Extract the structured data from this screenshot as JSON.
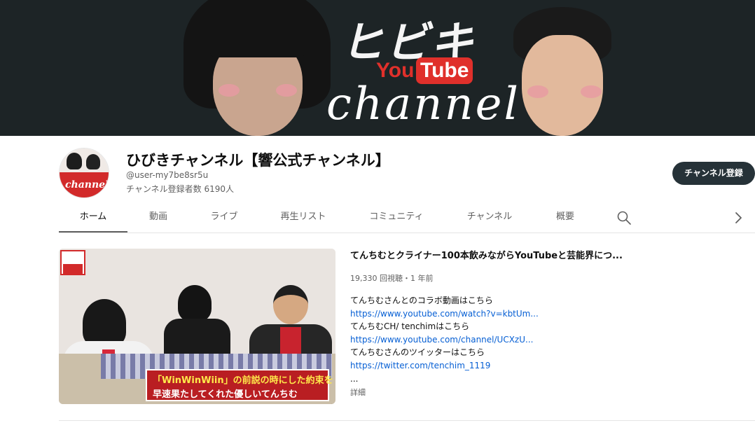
{
  "banner": {
    "title": "ヒビキ",
    "yt_you": "You",
    "yt_tube": "Tube",
    "script": "channel"
  },
  "avatar": {
    "text": "channel"
  },
  "channel": {
    "name": "ひびきチャンネル【響公式チャンネル】",
    "handle": "@user-my7be8sr5u",
    "subscribers": "チャンネル登録者数 6190人",
    "subscribe_label": "チャンネル登録"
  },
  "tabs": [
    {
      "label": "ホーム",
      "active": true
    },
    {
      "label": "動画"
    },
    {
      "label": "ライブ"
    },
    {
      "label": "再生リスト"
    },
    {
      "label": "コミュニティ"
    },
    {
      "label": "チャンネル"
    },
    {
      "label": "概要"
    }
  ],
  "icons": {
    "search": "search-icon",
    "next": "chevron-right-icon"
  },
  "featured": {
    "title": "てんちむとクライナー100本飲みながらYouTubeと芸能界につ...",
    "meta": "19,330 回視聴・1 年前",
    "thumb_caption_1": "「WinWinWiin」の前説の時にした約束を",
    "thumb_caption_2": "早速果たしてくれた優しいてんちむ",
    "description": [
      {
        "text": "てんちむさんとのコラボ動画はこちら",
        "link": false
      },
      {
        "text": "https://www.youtube.com/watch?v=kbtUm...",
        "link": true
      },
      {
        "text": "てんちむCH/ tenchimはこちら",
        "link": false
      },
      {
        "text": "https://www.youtube.com/channel/UCXzU...",
        "link": true
      },
      {
        "text": "てんちむさんのツイッターはこちら",
        "link": false
      },
      {
        "text": "https://twitter.com/tenchim_1119",
        "link": true
      },
      {
        "text": "...",
        "link": false
      }
    ],
    "details_label": "詳細"
  }
}
